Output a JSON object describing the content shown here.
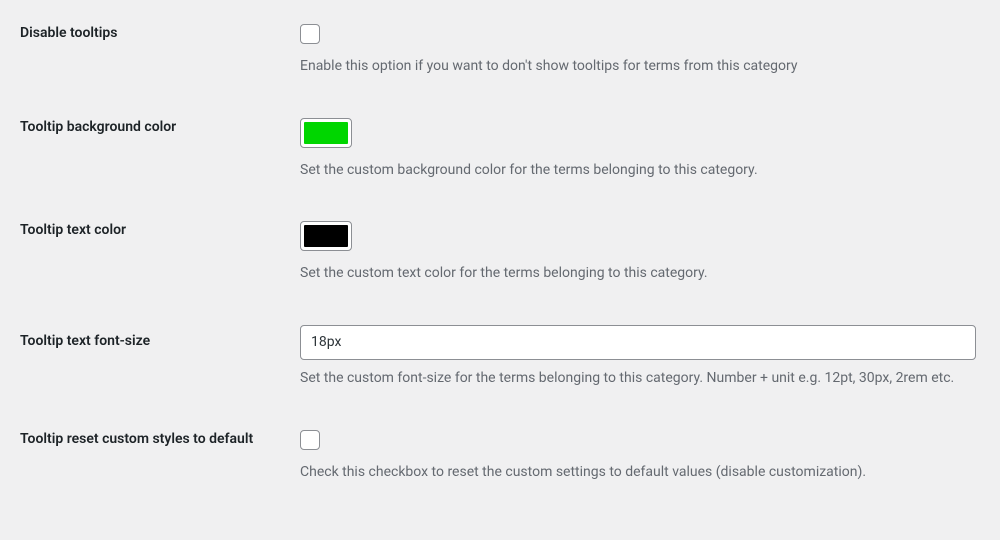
{
  "colors": {
    "background": "#00d600",
    "text": "#000000"
  },
  "rows": {
    "disable_tooltips": {
      "label": "Disable tooltips",
      "description": "Enable this option if you want to don't show tooltips for terms from this category",
      "checked": false
    },
    "bg_color": {
      "label": "Tooltip background color",
      "description": "Set the custom background color for the terms belonging to this category."
    },
    "text_color": {
      "label": "Tooltip text color",
      "description": "Set the custom text color for the terms belonging to this category."
    },
    "font_size": {
      "label": "Tooltip text font-size",
      "value": "18px",
      "description": "Set the custom font-size for the terms belonging to this category. Number + unit e.g. 12pt, 30px, 2rem etc."
    },
    "reset": {
      "label": "Tooltip reset custom styles to default",
      "description": "Check this checkbox to reset the custom settings to default values (disable customization).",
      "checked": false
    }
  }
}
